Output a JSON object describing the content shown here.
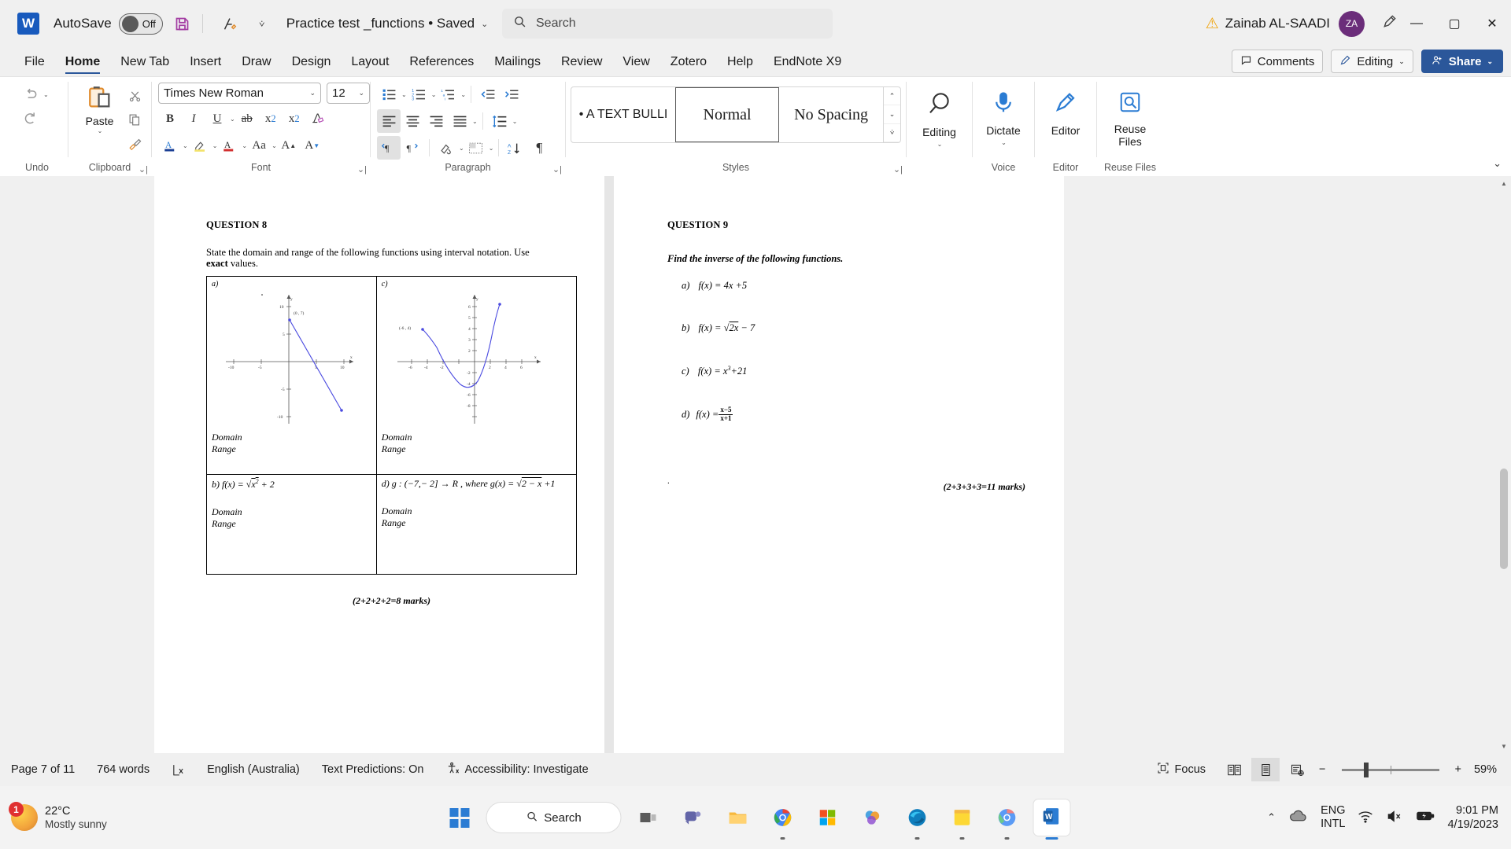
{
  "titlebar": {
    "app_logo": "word-logo",
    "autosave_label": "AutoSave",
    "autosave_state": "Off",
    "save_icon": "save-icon",
    "undo_pen_icon": "editor-pen-icon",
    "customize_icon": "chevron-down-icon",
    "document_title": "Practice test _functions • Saved",
    "title_chevron": "⌄",
    "search_placeholder": "Search",
    "warning_icon": "warning-triangle-icon",
    "user_name": "Zainab AL-SAADI",
    "user_initials": "ZA",
    "draw_icon": "pen-icon",
    "minimize": "—",
    "maximize": "▢",
    "close": "✕"
  },
  "tabs": [
    {
      "label": "File",
      "active": false
    },
    {
      "label": "Home",
      "active": true
    },
    {
      "label": "New Tab",
      "active": false
    },
    {
      "label": "Insert",
      "active": false
    },
    {
      "label": "Draw",
      "active": false
    },
    {
      "label": "Design",
      "active": false
    },
    {
      "label": "Layout",
      "active": false
    },
    {
      "label": "References",
      "active": false
    },
    {
      "label": "Mailings",
      "active": false
    },
    {
      "label": "Review",
      "active": false
    },
    {
      "label": "View",
      "active": false
    },
    {
      "label": "Zotero",
      "active": false
    },
    {
      "label": "Help",
      "active": false
    },
    {
      "label": "EndNote X9",
      "active": false
    }
  ],
  "tab_actions": {
    "comments_label": "Comments",
    "comments_icon": "comment-icon",
    "editing_label": "Editing",
    "editing_icon": "pencil-icon",
    "editing_chevron": "⌄",
    "share_label": "Share",
    "share_icon": "share-person-icon",
    "share_chevron": "⌄"
  },
  "ribbon": {
    "groups": [
      {
        "name": "undo",
        "label": "Undo"
      },
      {
        "name": "clipboard",
        "label": "Clipboard",
        "paste_label": "Paste"
      },
      {
        "name": "font",
        "label": "Font"
      },
      {
        "name": "paragraph",
        "label": "Paragraph"
      },
      {
        "name": "styles",
        "label": "Styles"
      },
      {
        "name": "voice",
        "label": "Voice",
        "button": "Dictate"
      },
      {
        "name": "editor",
        "label": "Editor",
        "button": "Editor"
      },
      {
        "name": "reuse",
        "label": "Reuse Files",
        "button": "Reuse Files"
      }
    ],
    "editing_button": "Editing",
    "font_name": "Times New Roman",
    "font_size": "12",
    "styles": [
      {
        "label": "• A TEXT BULLI",
        "selected": false
      },
      {
        "label": "Normal",
        "selected": true
      },
      {
        "label": "No Spacing",
        "selected": false
      }
    ],
    "collapse_icon": "chevron-up-icon"
  },
  "document": {
    "left_page": {
      "question_heading": "QUESTION 8",
      "instruction_part1": "State the domain and range of the following functions using interval notation. Use ",
      "instruction_bold": "exact",
      "instruction_part2": " values.",
      "cells": [
        {
          "id": "a",
          "label": "a)",
          "graph": "line-graph-decreasing",
          "point_label": "(0 , 7)",
          "domain": "Domain",
          "range": "Range"
        },
        {
          "id": "c",
          "label": "c)",
          "graph": "parabola-graph",
          "point_label": "(-6 , 4)",
          "domain": "Domain",
          "range": "Range"
        },
        {
          "id": "b",
          "label": "b)",
          "expr": "f(x) = √x² + 2",
          "domain": "Domain",
          "range": "Range"
        },
        {
          "id": "d",
          "label": "d)",
          "expr": "g : (−7,− 2] → R , where g(x) = √2 − x +1",
          "domain": "Domain",
          "range": "Range"
        }
      ],
      "marks": "(2+2+2+2=8 marks)"
    },
    "right_page": {
      "question_heading": "QUESTION 9",
      "instruction": "Find the inverse of the following functions.",
      "items": [
        {
          "label": "a)",
          "expr": "f(x) = 4x +5"
        },
        {
          "label": "b)",
          "expr": "f(x) = √2x − 7"
        },
        {
          "label": "c)",
          "expr": "f(x) = x³+21"
        },
        {
          "label": "d)",
          "expr_num": "x−5",
          "expr_den": "x+1",
          "expr_prefix": "f(x) = "
        }
      ],
      "marks": "(2+3+3+3=11 marks)"
    }
  },
  "statusbar": {
    "page": "Page 7 of 11",
    "words": "764 words",
    "proofing_icon": "spelling-check-icon",
    "language": "English (Australia)",
    "text_predictions": "Text Predictions: On",
    "accessibility_icon": "accessibility-icon",
    "accessibility": "Accessibility: Investigate",
    "focus_icon": "focus-icon",
    "focus": "Focus",
    "view_read": "read-mode-icon",
    "view_print": "print-layout-icon",
    "view_web": "web-layout-icon",
    "zoom_out": "−",
    "zoom_in": "+",
    "zoom_level": "59%"
  },
  "taskbar": {
    "weather_temp": "22°C",
    "weather_desc": "Mostly sunny",
    "weather_badge": "1",
    "start_icon": "windows-start-icon",
    "search_label": "Search",
    "search_icon": "search-icon",
    "apps": [
      {
        "name": "task-view-icon"
      },
      {
        "name": "teams-icon"
      },
      {
        "name": "file-explorer-icon"
      },
      {
        "name": "chrome-icon"
      },
      {
        "name": "store-icon"
      },
      {
        "name": "photos-icon"
      },
      {
        "name": "edge-icon"
      },
      {
        "name": "sticky-notes-icon"
      },
      {
        "name": "chrome-beta-icon"
      },
      {
        "name": "word-icon"
      }
    ],
    "tray_chevron": "⌃",
    "cloud_icon": "onedrive-icon",
    "lang_line1": "ENG",
    "lang_line2": "INTL",
    "wifi_icon": "wifi-icon",
    "volume_icon": "volume-muted-icon",
    "battery_icon": "battery-charging-icon",
    "time": "9:01 PM",
    "date": "4/19/2023"
  }
}
